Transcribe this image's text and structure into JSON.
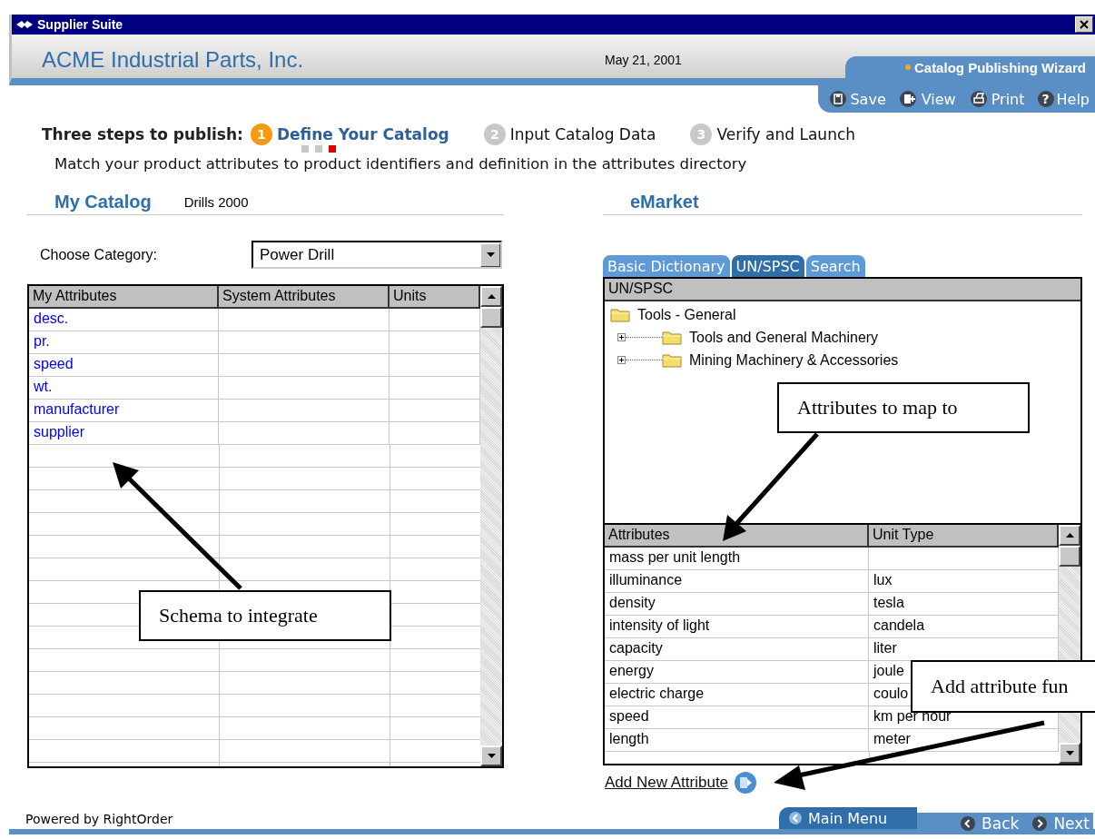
{
  "window": {
    "title": "Supplier Suite"
  },
  "header": {
    "company": "ACME Industrial Parts, Inc.",
    "date": "May 21, 2001",
    "wizard": "Catalog Publishing Wizard"
  },
  "toolbar": [
    {
      "kind": "save",
      "label": "Save"
    },
    {
      "kind": "view",
      "label": "View"
    },
    {
      "kind": "print",
      "label": "Print"
    },
    {
      "kind": "help",
      "label": "Help",
      "glyph": "?"
    }
  ],
  "steps": {
    "intro": "Three steps to publish:",
    "items": [
      {
        "number": "1",
        "label": "Define Your Catalog",
        "selected": true
      },
      {
        "number": "2",
        "label": "Input Catalog Data",
        "selected": false
      },
      {
        "number": "3",
        "label": "Verify and Launch",
        "selected": false
      }
    ],
    "substeps": [
      {
        "current": false
      },
      {
        "current": false
      },
      {
        "current": true
      }
    ]
  },
  "instruction": "Match your product attributes to product identifiers and definition in the attributes directory",
  "my_catalog": {
    "title": "My Catalog",
    "catalog_name": "Drills 2000",
    "category_label": "Choose Category:",
    "category": "Power Drill",
    "columns": [
      "My Attributes",
      "System Attributes",
      "Units"
    ],
    "rows": [
      [
        "desc.",
        "",
        ""
      ],
      [
        "pr.",
        "",
        ""
      ],
      [
        "speed",
        "",
        ""
      ],
      [
        "wt.",
        "",
        ""
      ],
      [
        "manufacturer",
        "",
        ""
      ],
      [
        "supplier",
        "",
        ""
      ]
    ]
  },
  "emarket": {
    "title": "eMarket",
    "tabs": [
      {
        "label": "Basic Dictionary",
        "selected": false
      },
      {
        "label": "UN/SPSC",
        "selected": true
      },
      {
        "label": "Search",
        "selected": false
      }
    ],
    "tree_header": "UN/SPSC",
    "tree": [
      {
        "label": "Tools - General",
        "children": [
          {
            "label": "Tools and General Machinery",
            "expanded": false
          },
          {
            "label": "Mining Machinery & Accessories",
            "expanded": false
          }
        ]
      }
    ],
    "columns": [
      "Attributes",
      "Unit Type"
    ],
    "rows": [
      [
        "mass per unit length",
        ""
      ],
      [
        "illuminance",
        "lux"
      ],
      [
        "density",
        "tesla"
      ],
      [
        "intensity of light",
        "candela"
      ],
      [
        "capacity",
        "liter"
      ],
      [
        "energy",
        "joule"
      ],
      [
        "electric charge",
        "coulo"
      ],
      [
        "speed",
        "km per hour"
      ],
      [
        "length",
        "meter"
      ]
    ],
    "add_link": "Add New Attribute"
  },
  "footer": {
    "powered_by": "Powered by RightOrder",
    "main_menu": "Main Menu",
    "back": "Back",
    "next": "Next"
  },
  "annotations": [
    {
      "text": "Schema to integrate"
    },
    {
      "text": "Attributes to map to"
    },
    {
      "text": "Add attribute fun"
    }
  ]
}
